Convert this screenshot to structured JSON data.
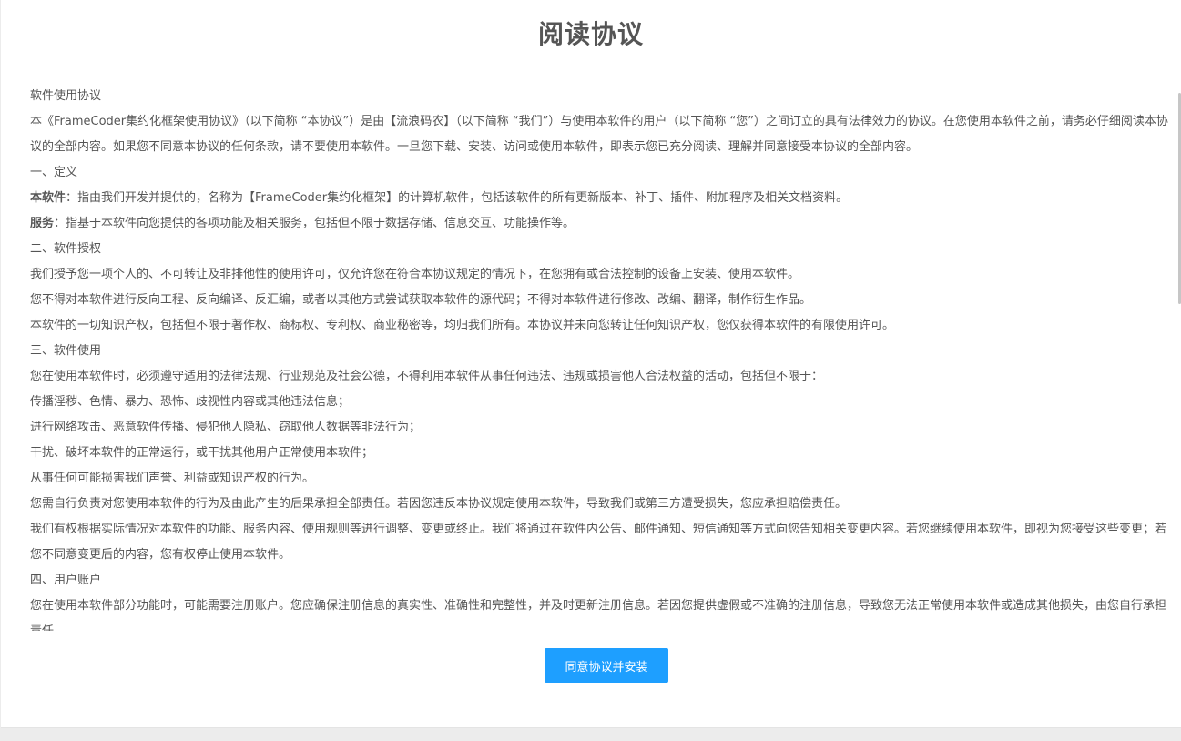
{
  "dialog": {
    "title": "阅读协议",
    "agree_button": "同意协议并安装"
  },
  "agreement": {
    "heading": "软件使用协议",
    "intro": "本《FrameCoder集约化框架使用协议》（以下简称 “本协议”）是由【流浪码农】（以下简称 “我们”）与使用本软件的用户（以下简称 “您”）之间订立的具有法律效力的协议。在您使用本软件之前，请务必仔细阅读本协议的全部内容。如果您不同意本协议的任何条款，请不要使用本软件。一旦您下载、安装、访问或使用本软件，即表示您已充分阅读、理解并同意接受本协议的全部内容。",
    "s1_title": "一、定义",
    "def1_term": "本软件",
    "def1_text": "：指由我们开发并提供的，名称为【FrameCoder集约化框架】的计算机软件，包括该软件的所有更新版本、补丁、插件、附加程序及相关文档资料。",
    "def2_term": "服务",
    "def2_text": "：指基于本软件向您提供的各项功能及相关服务，包括但不限于数据存储、信息交互、功能操作等。",
    "s2_title": "二、软件授权",
    "s2_p1": "我们授予您一项个人的、不可转让及非排他性的使用许可，仅允许您在符合本协议规定的情况下，在您拥有或合法控制的设备上安装、使用本软件。",
    "s2_p2": "您不得对本软件进行反向工程、反向编译、反汇编，或者以其他方式尝试获取本软件的源代码；不得对本软件进行修改、改编、翻译，制作衍生作品。",
    "s2_p3": "本软件的一切知识产权，包括但不限于著作权、商标权、专利权、商业秘密等，均归我们所有。本协议并未向您转让任何知识产权，您仅获得本软件的有限使用许可。",
    "s3_title": "三、软件使用",
    "s3_p1": "您在使用本软件时，必须遵守适用的法律法规、行业规范及社会公德，不得利用本软件从事任何违法、违规或损害他人合法权益的活动，包括但不限于：",
    "s3_li1": "传播淫秽、色情、暴力、恐怖、歧视性内容或其他违法信息；",
    "s3_li2": "进行网络攻击、恶意软件传播、侵犯他人隐私、窃取他人数据等非法行为；",
    "s3_li3": "干扰、破坏本软件的正常运行，或干扰其他用户正常使用本软件；",
    "s3_li4": "从事任何可能损害我们声誉、利益或知识产权的行为。",
    "s3_p2": "您需自行负责对您使用本软件的行为及由此产生的后果承担全部责任。若因您违反本协议规定使用本软件，导致我们或第三方遭受损失，您应承担赔偿责任。",
    "s3_p3": "我们有权根据实际情况对本软件的功能、服务内容、使用规则等进行调整、变更或终止。我们将通过在软件内公告、邮件通知、短信通知等方式向您告知相关变更内容。若您继续使用本软件，即视为您接受这些变更；若您不同意变更后的内容，您有权停止使用本软件。",
    "s4_title": "四、用户账户",
    "s4_p1": "您在使用本软件部分功能时，可能需要注册账户。您应确保注册信息的真实性、准确性和完整性，并及时更新注册信息。若因您提供虚假或不准确的注册信息，导致您无法正常使用本软件或造成其他损失，由您自行承担责任。"
  },
  "colors": {
    "primary_button": "#1e9fff",
    "text": "#555555",
    "background": "#ffffff"
  }
}
